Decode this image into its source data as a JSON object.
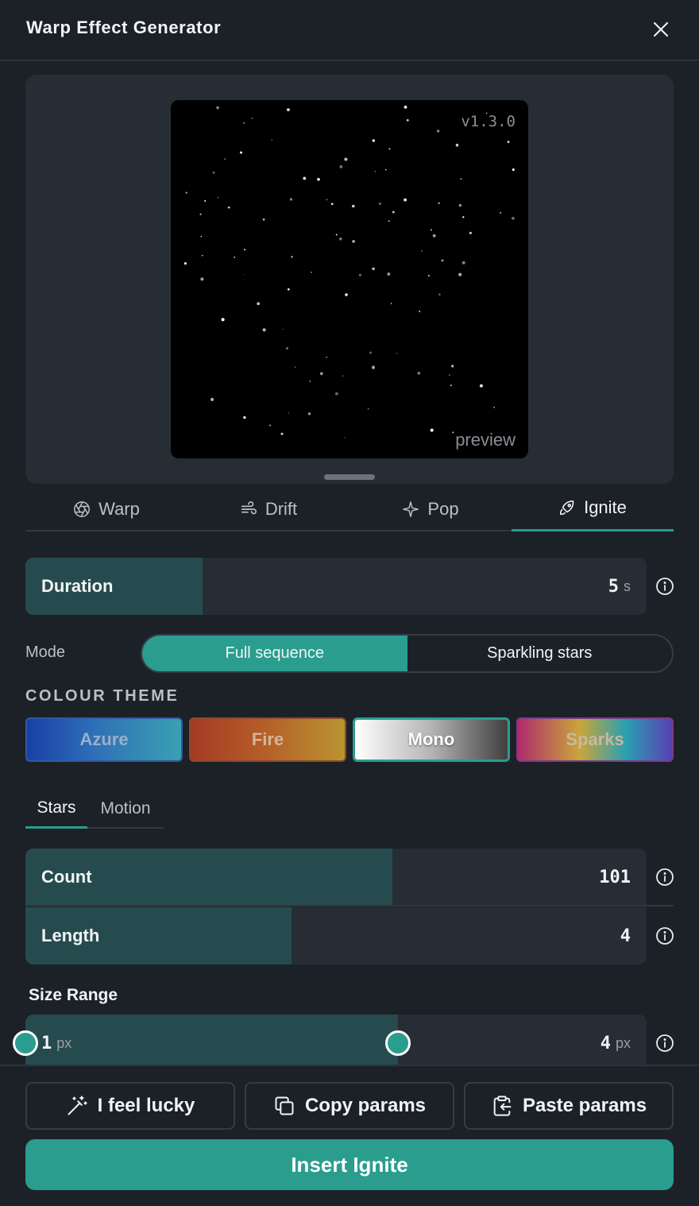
{
  "window": {
    "title": "Warp Effect Generator"
  },
  "preview": {
    "version": "v1.3.0",
    "label": "preview"
  },
  "tabs": [
    {
      "label": "Warp",
      "icon": "aperture-icon"
    },
    {
      "label": "Drift",
      "icon": "wind-icon"
    },
    {
      "label": "Pop",
      "icon": "sparkle-icon"
    },
    {
      "label": "Ignite",
      "icon": "rocket-icon",
      "active": true
    }
  ],
  "duration": {
    "label": "Duration",
    "value": "5",
    "unit": "s",
    "fill_fraction": 0.285
  },
  "mode": {
    "label": "Mode",
    "options": [
      "Full sequence",
      "Sparkling stars"
    ],
    "selected": "Full sequence"
  },
  "colour_theme": {
    "heading": "COLOUR THEME",
    "options": [
      "Azure",
      "Fire",
      "Mono",
      "Sparks"
    ],
    "selected": "Mono"
  },
  "subtabs": [
    {
      "label": "Stars",
      "active": true
    },
    {
      "label": "Motion"
    }
  ],
  "count": {
    "label": "Count",
    "value": "101",
    "fill_fraction": 0.59
  },
  "length": {
    "label": "Length",
    "value": "4",
    "fill_fraction": 0.43
  },
  "size_range": {
    "label": "Size Range",
    "min_value": "1",
    "max_value": "4",
    "unit": "px"
  },
  "footer": {
    "lucky_label": "I feel lucky",
    "copy_label": "Copy params",
    "paste_label": "Paste params",
    "insert_label": "Insert Ignite"
  },
  "colors": {
    "accent": "#2a9d8f",
    "background": "#1c2127",
    "panel": "#262d35",
    "fill": "#264b4e"
  }
}
